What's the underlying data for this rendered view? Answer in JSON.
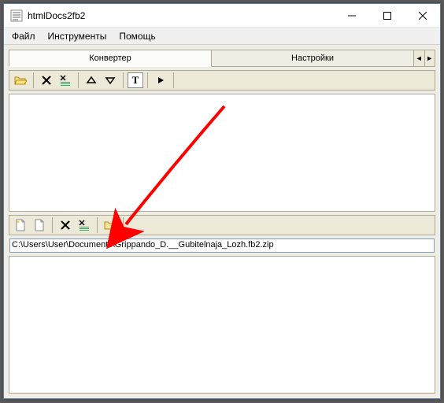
{
  "window": {
    "title": "htmlDocs2fb2"
  },
  "menubar": {
    "file": "Файл",
    "tools": "Инструменты",
    "help": "Помощь"
  },
  "tabs": {
    "converter": "Конвертер",
    "settings": "Настройки"
  },
  "output_path": "C:\\Users\\User\\Documents\\Grippando_D.__Gubitelnaja_Lozh.fb2.zip"
}
